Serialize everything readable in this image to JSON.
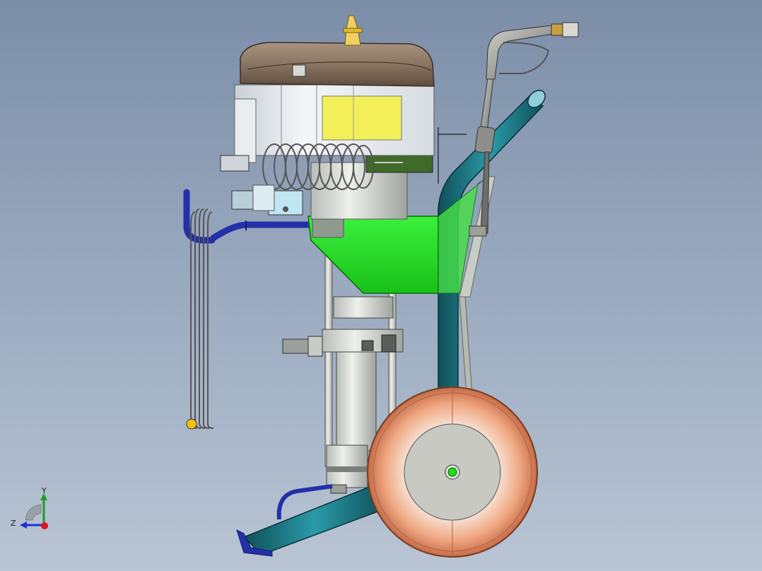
{
  "axis_triad": {
    "y_label": "Y",
    "z_label": "Z",
    "y_color": "#1f9a2a",
    "z_color": "#1e2fd0",
    "x_color": "#e0141e"
  },
  "colors": {
    "background_top": "#7c8ea8",
    "background_bottom": "#b9c5d4",
    "frame_tube": "#1d7a86",
    "hopper": "#2be22b",
    "wheel_tire": "#f2b79a",
    "wheel_hub": "#c9c9c4",
    "engine_cover": "#8b7765",
    "fuel_window": "#f2ef58",
    "hose": "#2430a8"
  }
}
